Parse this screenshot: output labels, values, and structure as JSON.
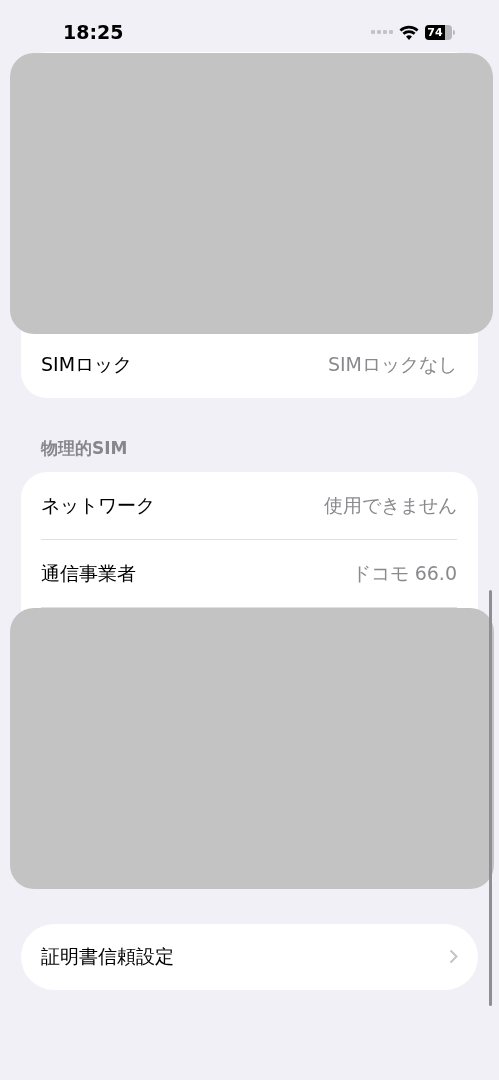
{
  "status_bar": {
    "time": "18:25",
    "battery": "74"
  },
  "sim_lock_card": {
    "rows": [
      {
        "label": "SIMロック",
        "value": "SIMロックなし"
      }
    ]
  },
  "physical_sim": {
    "header": "物理的SIM",
    "rows": [
      {
        "label": "ネットワーク",
        "value": "使用できません"
      },
      {
        "label": "通信事業者",
        "value": "ドコモ 66.0"
      }
    ]
  },
  "certificate_row": {
    "label": "証明書信頼設定"
  }
}
